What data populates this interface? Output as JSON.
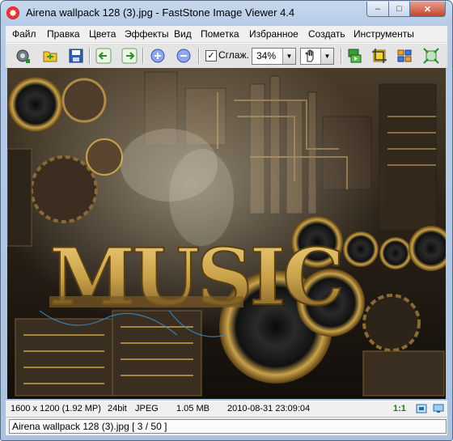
{
  "window": {
    "title": "Airena wallpack 128 (3).jpg  -  FastStone Image Viewer 4.4",
    "minimize_label": "–",
    "maximize_label": "□",
    "close_label": "✕"
  },
  "menu": {
    "items": [
      "Файл",
      "Правка",
      "Цвета",
      "Эффекты",
      "Вид",
      "Пометка",
      "Избранное",
      "Создать",
      "Инструменты"
    ]
  },
  "toolbar": {
    "smooth_label": "Сглаж.",
    "smooth_checked": true,
    "checkbox_mark": "✓",
    "zoom_value": "34%",
    "combo_arrow": "▼",
    "icons": [
      "browser-icon",
      "open-folder-icon",
      "save-disk-icon",
      "previous-arrow-icon",
      "next-arrow-icon",
      "zoom-in-icon",
      "zoom-out-icon",
      "hand-tool-icon",
      "slideshow-icon",
      "crop-icon",
      "thumbnails-icon",
      "fullscreen-icon"
    ]
  },
  "image": {
    "text": "MUSIC",
    "colors": {
      "gold": "#c9a24a",
      "dark": "#1c1710"
    }
  },
  "status": {
    "dimensions": "1600 x 1200 (1.92 MP)",
    "bit_depth": "24bit",
    "format": "JPEG",
    "file_size": "1.05 MB",
    "datetime": "2010-08-31 23:09:04",
    "zoom_ratio": "1:1",
    "filename_line": "Airena wallpack 128 (3).jpg [ 3 / 50 ]"
  }
}
